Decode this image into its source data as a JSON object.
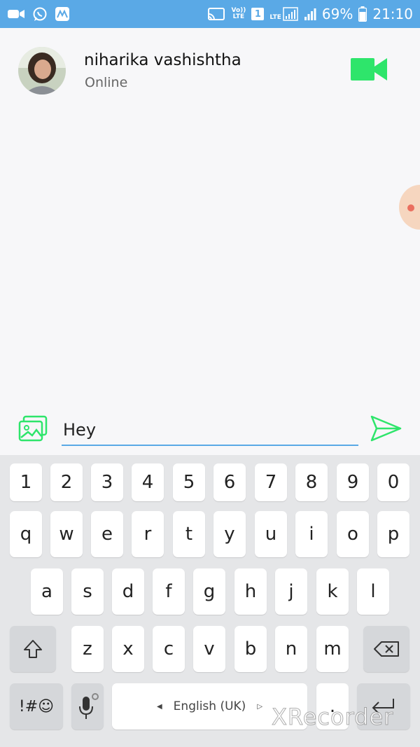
{
  "status_bar": {
    "volte_top": "Vo))",
    "volte_bottom": "LTE",
    "sim_slot": "1",
    "lte_label": "LTE",
    "battery": "69%",
    "time": "21:10"
  },
  "chat_header": {
    "name": "niharika vashishtha",
    "status": "Online"
  },
  "composer": {
    "message_value": "Hey"
  },
  "keyboard": {
    "row_numbers": [
      "1",
      "2",
      "3",
      "4",
      "5",
      "6",
      "7",
      "8",
      "9",
      "0"
    ],
    "row_1": [
      "q",
      "w",
      "e",
      "r",
      "t",
      "y",
      "u",
      "i",
      "o",
      "p"
    ],
    "row_2": [
      "a",
      "s",
      "d",
      "f",
      "g",
      "h",
      "j",
      "k",
      "l"
    ],
    "row_3": [
      "z",
      "x",
      "c",
      "v",
      "b",
      "n",
      "m"
    ],
    "symbols_label": "!#☺",
    "space_label": "English (UK)",
    "period_label": "."
  },
  "watermark": "XRecorder",
  "colors": {
    "status_bar": "#5aa9e6",
    "accent_green": "#2ee56b",
    "input_underline": "#5aa9e6",
    "keyboard_bg": "#e5e6e8"
  },
  "icons": {
    "video_call": "video-camera-icon",
    "gallery": "gallery-icon",
    "send": "send-icon",
    "shift": "shift-icon",
    "backspace": "backspace-icon",
    "mic": "microphone-icon",
    "enter": "enter-icon"
  }
}
